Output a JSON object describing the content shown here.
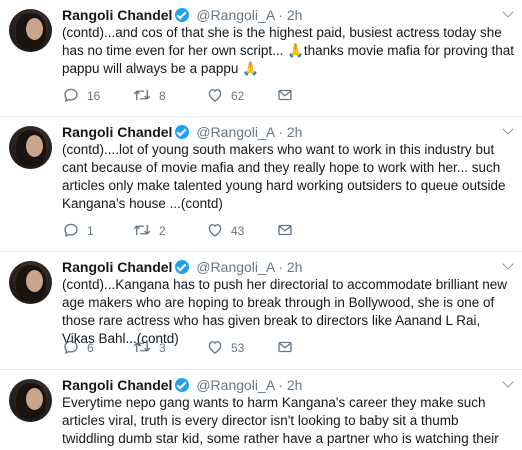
{
  "author": {
    "name": "Rangoli Chandel",
    "handle": "@Rangoli_A",
    "separator": "·"
  },
  "tweets": [
    {
      "time": "2h",
      "text": "(contd)...and cos of that she is the highest paid, busiest actress today she has no time even for her own script... 🙏thanks movie mafia for proving that pappu will always be a pappu 🙏",
      "replies": "16",
      "retweets": "8",
      "likes": "62"
    },
    {
      "time": "2h",
      "text": "(contd)....lot of young south makers who want to work in this industry but cant because of movie mafia and they really hope to work with her... such articles only make talented young hard working outsiders to queue outside Kangana's house ...(contd)",
      "replies": "1",
      "retweets": "2",
      "likes": "43"
    },
    {
      "time": "2h",
      "text": "(contd)...Kangana has to push her directorial to accommodate brilliant new age makers who are hoping to break through in Bollywood, she is one of those rare actress who has given break to directors like Aanand L Rai, Vikas Bahl...(contd)",
      "replies": "6",
      "retweets": "3",
      "likes": "53"
    },
    {
      "time": "2h",
      "text": "Everytime nepo gang wants to harm Kangana's career they make such articles viral, truth is every director isn't looking to baby sit a thumb twiddling dumb star kid, some rather have a partner who is watching their back...(contd)"
    }
  ],
  "icons": {
    "reply": "reply-icon",
    "retweet": "retweet-icon",
    "like": "like-icon",
    "message": "direct-message-icon",
    "more": "chevron-down-icon"
  },
  "colors": {
    "text": "#14171a",
    "secondary": "#657786",
    "verified": "#1da1f2",
    "divider": "#e6ecf0"
  }
}
